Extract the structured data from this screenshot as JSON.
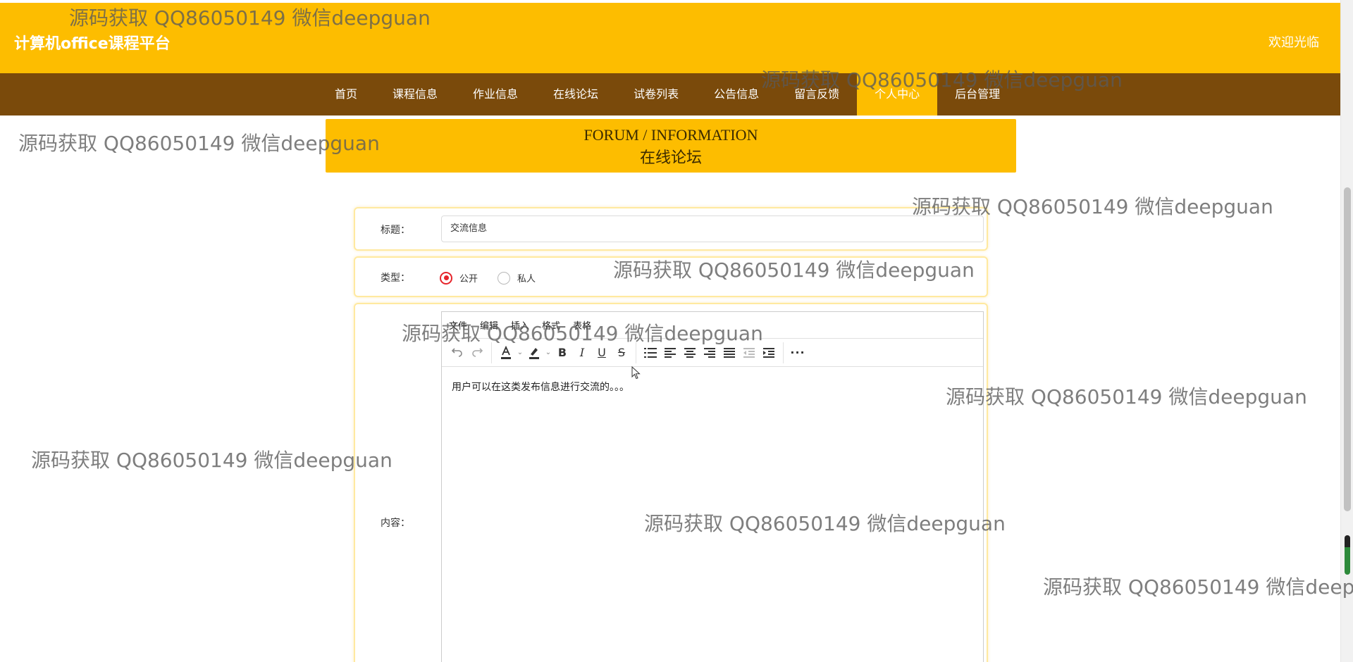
{
  "header": {
    "site_title": "计算机office课程平台",
    "welcome": "欢迎光临"
  },
  "nav": {
    "items": [
      {
        "label": "首页"
      },
      {
        "label": "课程信息"
      },
      {
        "label": "作业信息"
      },
      {
        "label": "在线论坛"
      },
      {
        "label": "试卷列表"
      },
      {
        "label": "公告信息"
      },
      {
        "label": "留言反馈"
      },
      {
        "label": "个人中心",
        "active": true
      },
      {
        "label": "后台管理"
      }
    ]
  },
  "banner": {
    "en": "FORUM / INFORMATION",
    "cn": "在线论坛"
  },
  "form": {
    "title_label": "标题：",
    "title_value": "交流信息",
    "type_label": "类型：",
    "type_options": [
      {
        "label": "公开",
        "checked": true
      },
      {
        "label": "私人",
        "checked": false
      }
    ],
    "content_label": "内容："
  },
  "editor": {
    "menus": [
      "文件",
      "编辑",
      "插入",
      "格式",
      "表格"
    ],
    "toolbar_icons": [
      "undo-icon",
      "redo-icon",
      "font-color-icon",
      "highlight-color-icon",
      "bold-icon",
      "italic-icon",
      "underline-icon",
      "strikethrough-icon",
      "numbered-list-icon",
      "align-left-icon",
      "align-center-icon",
      "align-right-icon",
      "justify-icon",
      "outdent-icon",
      "indent-icon",
      "more-icon"
    ],
    "body_text": "用户可以在这类发布信息进行交流的。。。"
  },
  "watermark_text": "源码获取 QQ86050149 微信deepguan",
  "colors": {
    "header_bg": "#fdbd00",
    "nav_bg": "#7a4a0b",
    "accent_red": "#e6242b"
  }
}
